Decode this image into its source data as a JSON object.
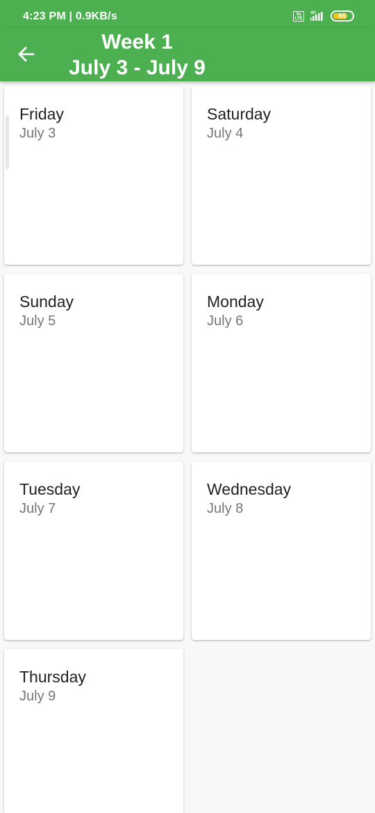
{
  "status_bar": {
    "time_speed": "4:23 PM | 0.9KB/s",
    "volte_label": "Vo LTE",
    "network_label": "4G",
    "battery_level": "65",
    "icons": [
      "volte-icon",
      "signal-icon",
      "battery-icon"
    ]
  },
  "header": {
    "back_icon": "arrow-left-icon",
    "title": "Week 1",
    "subtitle": "July 3 - July 9"
  },
  "colors": {
    "app_bar": "#4caf50",
    "card": "#ffffff",
    "background": "#f8f8f8",
    "battery_fill": "#f5c518"
  },
  "days": [
    {
      "name": "Friday",
      "date": "July 3"
    },
    {
      "name": "Saturday",
      "date": "July 4"
    },
    {
      "name": "Sunday",
      "date": "July 5"
    },
    {
      "name": "Monday",
      "date": "July 6"
    },
    {
      "name": "Tuesday",
      "date": "July 7"
    },
    {
      "name": "Wednesday",
      "date": "July 8"
    },
    {
      "name": "Thursday",
      "date": "July 9"
    }
  ]
}
